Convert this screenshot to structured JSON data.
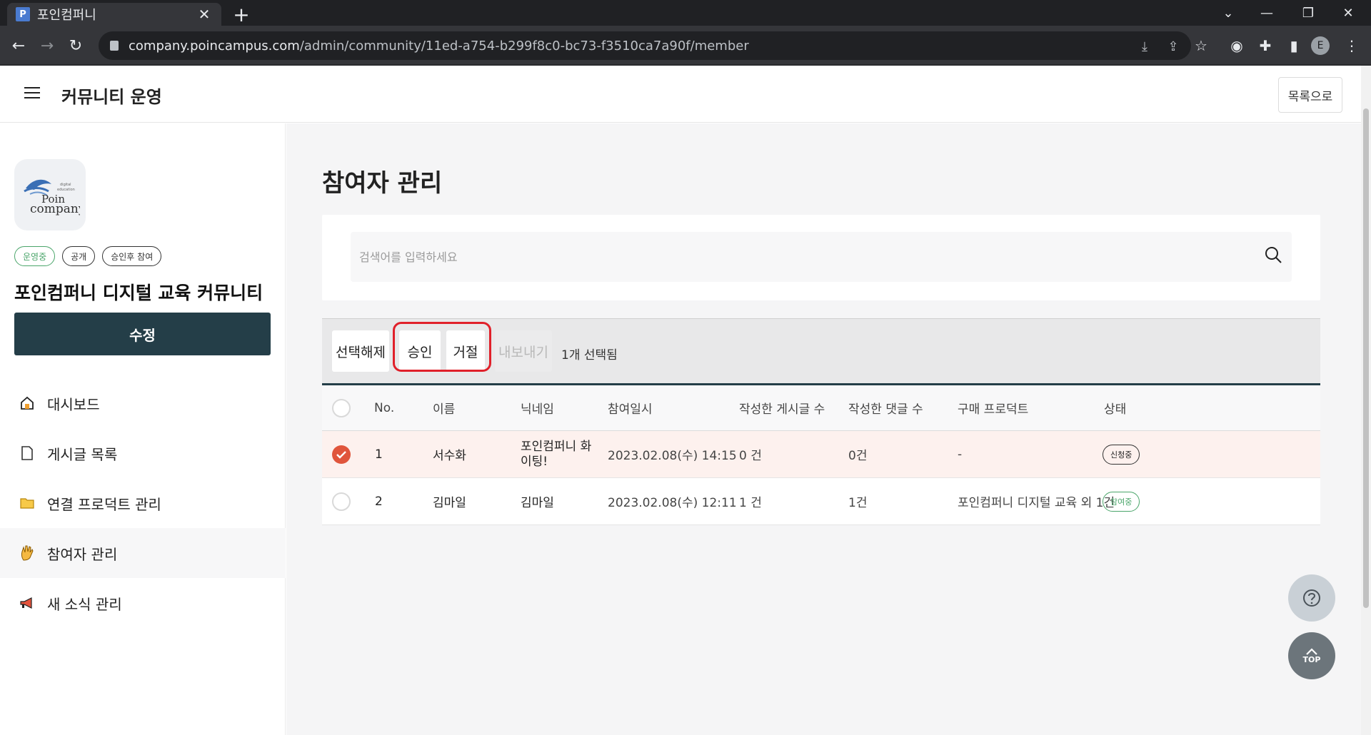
{
  "browser": {
    "tab_title": "포인컴퍼니",
    "favicon_letter": "P",
    "url_host": "company.poincampus.com",
    "url_path": "/admin/community/11ed-a754-b299f8c0-bc73-f3510ca7a90f/member",
    "profile_letter": "E"
  },
  "header": {
    "title": "커뮤니티 운영",
    "back_label": "목록으로"
  },
  "sidebar": {
    "logo_text": "Poin company",
    "badges": [
      {
        "label": "운영중",
        "color": "#4aa56a"
      },
      {
        "label": "공개",
        "color": "#333333"
      },
      {
        "label": "승인후 참여",
        "color": "#333333"
      }
    ],
    "community_name": "포인컴퍼니 디지털 교육 커뮤니티",
    "edit_label": "수정",
    "menu": [
      {
        "label": "대시보드",
        "icon": "home-icon"
      },
      {
        "label": "게시글 목록",
        "icon": "document-icon"
      },
      {
        "label": "연결 프로덕트 관리",
        "icon": "folder-icon"
      },
      {
        "label": "참여자 관리",
        "icon": "hand-icon",
        "active": true
      },
      {
        "label": "새 소식 관리",
        "icon": "megaphone-icon"
      }
    ]
  },
  "main": {
    "page_title": "참여자 관리",
    "search_placeholder": "검색어를 입력하세요",
    "toolbar": {
      "deselect": "선택해제",
      "approve": "승인",
      "reject": "거절",
      "export": "내보내기",
      "selected_count": "1개 선택됨"
    },
    "columns": [
      "No.",
      "이름",
      "닉네임",
      "참여일시",
      "작성한 게시글 수",
      "작성한 댓글 수",
      "구매 프로덕트",
      "상태"
    ],
    "rows": [
      {
        "checked": true,
        "no": "1",
        "name": "서수화",
        "nickname": "포인컴퍼니 화이팅!",
        "joined": "2023.02.08(수) 14:15",
        "posts": "0 건",
        "comments": "0건",
        "product": "-",
        "status": "신청중",
        "status_color": "#333333"
      },
      {
        "checked": false,
        "no": "2",
        "name": "김마일",
        "nickname": "김마일",
        "joined": "2023.02.08(수) 12:11",
        "posts": "1 건",
        "comments": "1건",
        "product": "포인컴퍼니 디지털 교육 외 1건",
        "status": "참여중",
        "status_color": "#4aa56a"
      }
    ]
  },
  "fab": {
    "help_icon": "question-icon",
    "top_label": "TOP"
  },
  "colors": {
    "primary_dark": "#243e48",
    "highlight_red": "#e0202a",
    "check_red": "#e0553c",
    "green": "#4aa56a"
  }
}
